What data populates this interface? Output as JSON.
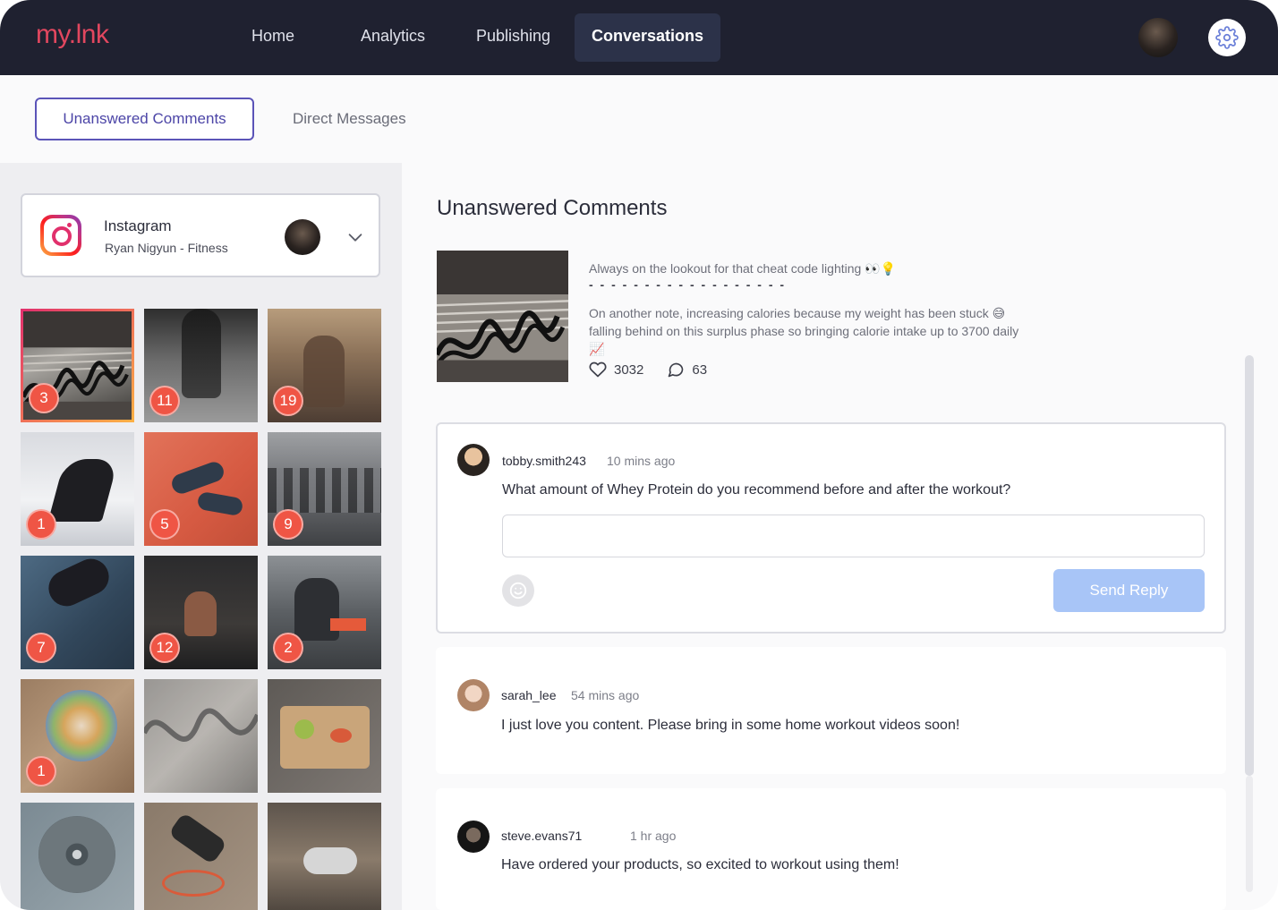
{
  "brand": {
    "logo": "my.lnk"
  },
  "nav": {
    "items": [
      {
        "label": "Home"
      },
      {
        "label": "Analytics"
      },
      {
        "label": "Publishing"
      },
      {
        "label": "Conversations"
      }
    ],
    "active": "Conversations",
    "icons": {
      "avatar": "user-avatar",
      "settings": "gear-icon"
    }
  },
  "subtabs": {
    "active_label": "Unanswered Comments",
    "other_label": "Direct Messages"
  },
  "account": {
    "platform": "Instagram",
    "name": "Ryan Nigyun - Fitness",
    "icon": "instagram-icon"
  },
  "posts": [
    {
      "badge": "3"
    },
    {
      "badge": "11"
    },
    {
      "badge": "19"
    },
    {
      "badge": "1"
    },
    {
      "badge": "5"
    },
    {
      "badge": "9"
    },
    {
      "badge": "7"
    },
    {
      "badge": "12"
    },
    {
      "badge": "2"
    },
    {
      "badge": "1"
    },
    {
      "badge": ""
    },
    {
      "badge": ""
    },
    {
      "badge": ""
    },
    {
      "badge": ""
    },
    {
      "badge": ""
    }
  ],
  "main": {
    "title": "Unanswered Comments",
    "post": {
      "caption_line1": "Always on the lookout for that cheat code lighting 👀💡",
      "caption_dashes": "- - - - - - - - - - - - - - - - - -",
      "caption_body": "On another note, increasing calories because my weight has been stuck 😅 falling behind on this surplus phase so bringing calorie intake up to 3700 daily 📈",
      "likes": "3032",
      "comments": "63"
    },
    "comments": [
      {
        "user": "tobby.smith243",
        "time": "10 mins ago",
        "text": "What amount of Whey Protein do you recommend before and after the workout?",
        "reply_placeholder": "",
        "send_label": "Send Reply"
      },
      {
        "user": "sarah_lee",
        "time": "54 mins ago",
        "text": "I just love you content. Please bring in some home workout videos soon!"
      },
      {
        "user": "steve.evans71",
        "time": "1 hr ago",
        "text": "Have ordered your products, so excited to workout using them!"
      }
    ]
  },
  "colors": {
    "nav_bg": "#1f2130",
    "accent": "#5b54b8",
    "badge": "#ef5545",
    "send_button": "#a8c5f7",
    "logo": "#e2475f"
  }
}
